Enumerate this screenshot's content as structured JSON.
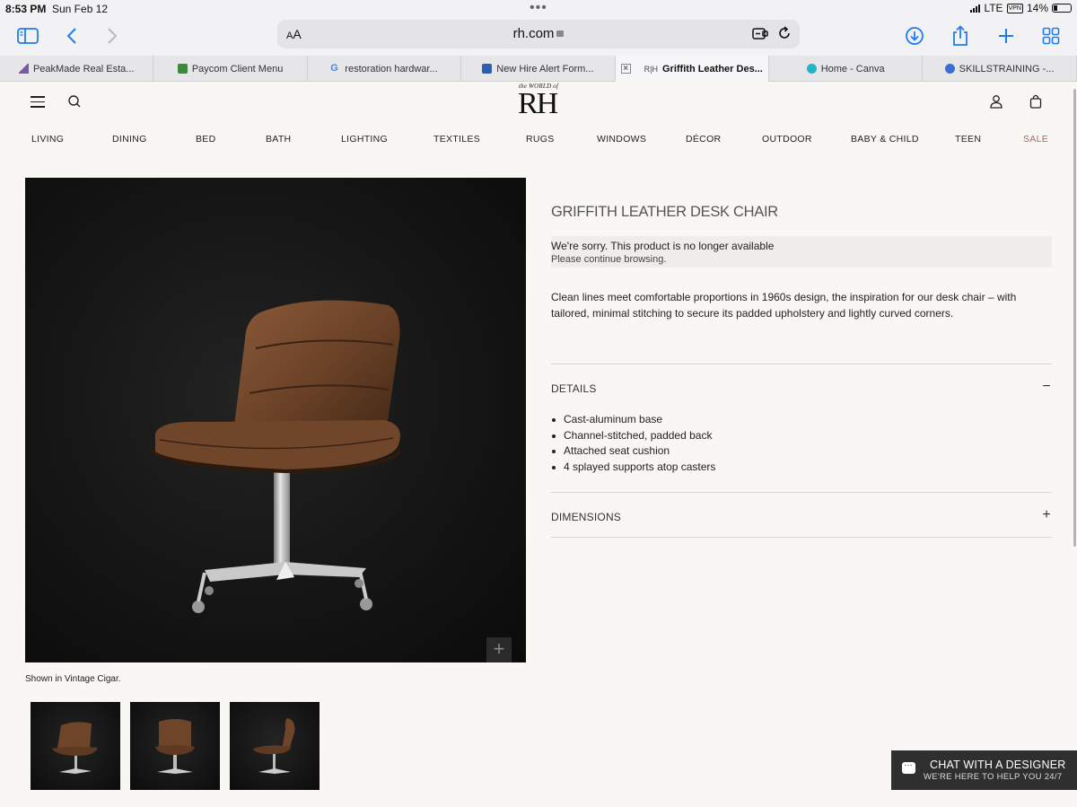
{
  "status_bar": {
    "time": "8:53 PM",
    "date": "Sun Feb 12",
    "network": "LTE",
    "vpn": "VPN",
    "battery": "14%"
  },
  "browser": {
    "aa_label_big": "A",
    "aa_label_small": "A",
    "url": "rh.com",
    "tabs": [
      {
        "label": "PeakMade Real Esta...",
        "favicon_color": "#7a5aa8"
      },
      {
        "label": "Paycom Client Menu",
        "favicon_color": "#3b8a3b"
      },
      {
        "label": "restoration hardwar...",
        "favicon_color": "#4285f4"
      },
      {
        "label": "New Hire Alert Form...",
        "favicon_color": "#2b5fb4"
      },
      {
        "label": "Griffith Leather Des...",
        "favicon_color": "#333333"
      },
      {
        "label": "Home - Canva",
        "favicon_color": "#20b4c8"
      },
      {
        "label": "SKILLSTRAINING -...",
        "favicon_color": "#3a6fd8"
      }
    ],
    "active_tab_prefix": "R|H",
    "accent_color": "#1f7cf0"
  },
  "site": {
    "logo_small": "the WORLD of",
    "logo_big": "RH",
    "nav": [
      "LIVING",
      "DINING",
      "BED",
      "BATH",
      "LIGHTING",
      "TEXTILES",
      "RUGS",
      "WINDOWS",
      "DÉCOR",
      "OUTDOOR",
      "BABY & CHILD",
      "TEEN",
      "SALE"
    ],
    "sale_color": "#a26a63"
  },
  "product": {
    "title": "GRIFFITH LEATHER DESK CHAIR",
    "notice_line1": "We're sorry. This product is no longer available",
    "notice_line2": "Please continue browsing.",
    "description": "Clean lines meet comfortable proportions in 1960s design, the inspiration for our desk chair – with tailored, minimal stitching to secure its padded upholstery and lightly curved corners.",
    "caption": "Shown in Vintage Cigar.",
    "zoom_symbol": "+",
    "details_label": "DETAILS",
    "details_toggle": "−",
    "details": [
      "Cast-aluminum base",
      "Channel-stitched, padded back",
      "Attached seat cushion",
      "4 splayed supports atop casters"
    ],
    "dimensions_label": "DIMENSIONS",
    "dimensions_toggle": "+"
  },
  "chat": {
    "title": "CHAT WITH A DESIGNER",
    "subtitle": "WE'RE HERE TO HELP YOU 24/7"
  }
}
